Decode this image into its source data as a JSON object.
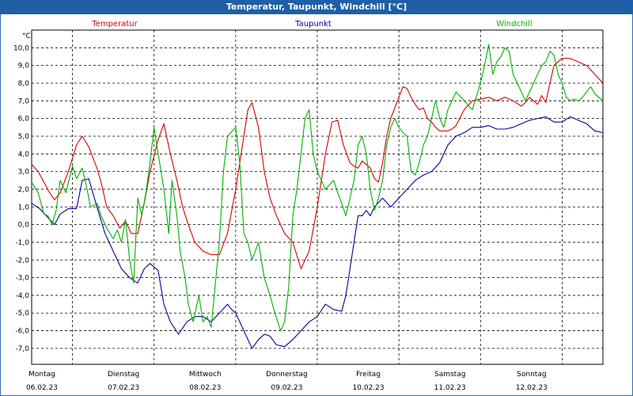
{
  "window": {
    "title": "Temperatur, Taupunkt, Windchill [°C]"
  },
  "chart_data": {
    "type": "line",
    "title": "Temperatur, Taupunkt, Windchill [°C]",
    "ylabel": "°C",
    "ylim": [
      -7.9,
      11.0
    ],
    "yticks": [
      -7.0,
      -6.0,
      -5.0,
      -4.0,
      -3.0,
      -2.0,
      -1.0,
      0.0,
      1.0,
      2.0,
      3.0,
      4.0,
      5.0,
      6.0,
      7.0,
      8.0,
      9.0,
      10.0
    ],
    "ytick_labels": [
      "-7,0",
      "-6,0",
      "-5,0",
      "-4,0",
      "-3,0",
      "-2,0",
      "-1,0",
      "0,0",
      "1,0",
      "2,0",
      "3,0",
      "4,0",
      "5,0",
      "6,0",
      "7,0",
      "8,0",
      "9,0",
      "10,0"
    ],
    "xlim": [
      0,
      7.0
    ],
    "x_unit": "days since Montag 06.02.23 00:00",
    "day_ticks": [
      {
        "day": "Montag",
        "date": "06.02.23"
      },
      {
        "day": "Dienstag",
        "date": "07.02.23"
      },
      {
        "day": "Mittwoch",
        "date": "08.02.23"
      },
      {
        "day": "Donnerstag",
        "date": "09.02.23"
      },
      {
        "day": "Freitag",
        "date": "10.02.23"
      },
      {
        "day": "Samstag",
        "date": "11.02.23"
      },
      {
        "day": "Sonntag",
        "date": "12.02.23"
      }
    ],
    "grid": true,
    "series": [
      {
        "name": "Temperatur",
        "color": "#d40000",
        "x": [
          0,
          0.08,
          0.15,
          0.22,
          0.28,
          0.35,
          0.45,
          0.55,
          0.62,
          0.7,
          0.8,
          0.85,
          0.92,
          1.0,
          1.08,
          1.15,
          1.22,
          1.3,
          1.38,
          1.45,
          1.55,
          1.62,
          1.7,
          1.78,
          1.85,
          1.92,
          2.0,
          2.1,
          2.2,
          2.3,
          2.4,
          2.5,
          2.6,
          2.65,
          2.7,
          2.78,
          2.85,
          2.92,
          3.0,
          3.1,
          3.2,
          3.3,
          3.4,
          3.5,
          3.6,
          3.68,
          3.75,
          3.82,
          3.9,
          3.95,
          4.0,
          4.05,
          4.1,
          4.15,
          4.2,
          4.25,
          4.3,
          4.35,
          4.4,
          4.5,
          4.55,
          4.6,
          4.65,
          4.7,
          4.75,
          4.8,
          4.85,
          4.9,
          4.95,
          5.0,
          5.05,
          5.1,
          5.15,
          5.2,
          5.3,
          5.4,
          5.5,
          5.6,
          5.7,
          5.8,
          5.9,
          6.0,
          6.05,
          6.1,
          6.15,
          6.2,
          6.25,
          6.3,
          6.35,
          6.4,
          6.5,
          6.6,
          6.7,
          6.8,
          6.9,
          7.0
        ],
        "y": [
          3.4,
          3.0,
          2.4,
          1.8,
          1.4,
          1.8,
          3.0,
          4.5,
          5.0,
          4.4,
          3.2,
          2.4,
          1.0,
          0.5,
          -0.2,
          0.2,
          -0.5,
          -0.5,
          1.2,
          3.0,
          4.8,
          5.7,
          4.0,
          2.5,
          1.0,
          0.0,
          -1.0,
          -1.5,
          -1.7,
          -1.7,
          -0.5,
          2.0,
          5.0,
          6.5,
          6.9,
          5.5,
          3.0,
          1.5,
          0.5,
          -0.5,
          -1.0,
          -2.5,
          -1.5,
          1.0,
          4.0,
          5.8,
          5.9,
          4.5,
          3.5,
          3.3,
          3.2,
          3.6,
          3.4,
          3.2,
          2.6,
          2.4,
          3.5,
          5.0,
          6.0,
          7.2,
          7.8,
          7.7,
          7.2,
          6.8,
          6.5,
          6.6,
          6.0,
          5.8,
          5.5,
          5.3,
          5.3,
          5.3,
          5.4,
          5.6,
          6.5,
          7.0,
          7.1,
          7.2,
          7.0,
          7.2,
          7.0,
          6.7,
          6.9,
          7.2,
          7.0,
          6.8,
          7.3,
          6.9,
          8.0,
          9.0,
          9.4,
          9.4,
          9.2,
          9.0,
          8.5,
          8.0
        ]
      },
      {
        "name": "Taupunkt",
        "color": "#00009c",
        "x": [
          0,
          0.1,
          0.2,
          0.28,
          0.35,
          0.45,
          0.55,
          0.62,
          0.7,
          0.8,
          0.9,
          1.0,
          1.1,
          1.2,
          1.3,
          1.38,
          1.45,
          1.55,
          1.62,
          1.7,
          1.8,
          1.9,
          2.0,
          2.1,
          2.2,
          2.3,
          2.4,
          2.45,
          2.5,
          2.6,
          2.65,
          2.7,
          2.78,
          2.85,
          2.92,
          3.0,
          3.1,
          3.2,
          3.3,
          3.4,
          3.5,
          3.6,
          3.7,
          3.8,
          3.85,
          3.9,
          3.95,
          4.0,
          4.05,
          4.1,
          4.15,
          4.2,
          4.3,
          4.4,
          4.5,
          4.6,
          4.7,
          4.8,
          4.9,
          5.0,
          5.1,
          5.2,
          5.3,
          5.4,
          5.5,
          5.6,
          5.7,
          5.8,
          5.9,
          6.0,
          6.1,
          6.2,
          6.3,
          6.4,
          6.5,
          6.6,
          6.7,
          6.8,
          6.9,
          7.0
        ],
        "y": [
          1.2,
          0.9,
          0.4,
          0.0,
          0.6,
          0.9,
          0.9,
          2.5,
          2.6,
          1.0,
          -0.5,
          -1.5,
          -2.5,
          -3.0,
          -3.3,
          -2.5,
          -2.2,
          -2.6,
          -4.5,
          -5.5,
          -6.2,
          -5.5,
          -5.2,
          -5.2,
          -5.5,
          -5.0,
          -4.5,
          -4.8,
          -5.0,
          -6.0,
          -6.5,
          -7.0,
          -6.5,
          -6.2,
          -6.3,
          -6.8,
          -6.9,
          -6.5,
          -6.0,
          -5.5,
          -5.2,
          -4.5,
          -4.8,
          -4.9,
          -4.0,
          -2.5,
          -1.0,
          0.5,
          0.5,
          0.8,
          0.5,
          1.0,
          1.5,
          1.0,
          1.5,
          2.0,
          2.5,
          2.8,
          3.0,
          3.5,
          4.5,
          5.0,
          5.2,
          5.5,
          5.5,
          5.6,
          5.4,
          5.4,
          5.5,
          5.7,
          5.9,
          6.0,
          6.1,
          5.8,
          5.8,
          6.1,
          5.9,
          5.7,
          5.3,
          5.2
        ]
      },
      {
        "name": "Windchill",
        "color": "#00b000",
        "x": [
          0,
          0.08,
          0.15,
          0.2,
          0.25,
          0.3,
          0.35,
          0.42,
          0.5,
          0.55,
          0.62,
          0.68,
          0.72,
          0.8,
          0.85,
          0.92,
          1.0,
          1.05,
          1.1,
          1.15,
          1.2,
          1.25,
          1.3,
          1.35,
          1.4,
          1.45,
          1.5,
          1.55,
          1.62,
          1.68,
          1.72,
          1.78,
          1.82,
          1.88,
          1.92,
          1.98,
          2.05,
          2.1,
          2.15,
          2.2,
          2.3,
          2.35,
          2.4,
          2.5,
          2.55,
          2.6,
          2.65,
          2.7,
          2.78,
          2.85,
          2.92,
          2.98,
          3.05,
          3.1,
          3.15,
          3.2,
          3.25,
          3.3,
          3.35,
          3.4,
          3.45,
          3.5,
          3.55,
          3.6,
          3.7,
          3.75,
          3.8,
          3.85,
          3.9,
          3.95,
          4.0,
          4.05,
          4.1,
          4.15,
          4.2,
          4.25,
          4.3,
          4.35,
          4.4,
          4.45,
          4.5,
          4.55,
          4.6,
          4.65,
          4.7,
          4.75,
          4.8,
          4.85,
          4.9,
          4.95,
          5.0,
          5.05,
          5.1,
          5.15,
          5.2,
          5.3,
          5.4,
          5.5,
          5.55,
          5.6,
          5.65,
          5.7,
          5.75,
          5.8,
          5.85,
          5.9,
          5.95,
          6.0,
          6.05,
          6.1,
          6.15,
          6.2,
          6.25,
          6.3,
          6.35,
          6.4,
          6.45,
          6.5,
          6.55,
          6.6,
          6.65,
          6.7,
          6.75,
          6.8,
          6.85,
          6.9,
          6.95,
          7.0
        ],
        "y": [
          2.4,
          1.8,
          0.6,
          0.5,
          0.0,
          0.8,
          2.5,
          1.8,
          3.3,
          2.6,
          3.2,
          2.0,
          1.0,
          1.2,
          0.5,
          -0.2,
          -0.8,
          -0.3,
          -1.0,
          0.3,
          -2.0,
          -3.3,
          1.5,
          0.5,
          1.8,
          3.5,
          5.5,
          4.0,
          2.0,
          -0.5,
          2.5,
          0.5,
          -1.5,
          -3.0,
          -4.5,
          -5.5,
          -4.0,
          -5.5,
          -5.2,
          -5.8,
          -1.0,
          3.0,
          5.0,
          5.5,
          3.5,
          -0.5,
          -1.0,
          -2.0,
          -1.0,
          -3.0,
          -4.0,
          -5.0,
          -6.0,
          -5.5,
          -3.5,
          0.5,
          2.0,
          4.0,
          6.0,
          6.5,
          4.0,
          3.0,
          2.5,
          2.0,
          2.5,
          1.8,
          1.2,
          0.5,
          1.5,
          2.5,
          4.5,
          5.0,
          4.0,
          2.0,
          0.8,
          1.5,
          2.5,
          4.5,
          5.5,
          6.0,
          5.5,
          5.2,
          5.0,
          3.0,
          2.8,
          3.5,
          4.5,
          5.0,
          6.0,
          7.0,
          6.0,
          5.5,
          6.5,
          7.0,
          7.5,
          7.0,
          6.5,
          8.0,
          9.0,
          10.2,
          8.5,
          9.2,
          9.5,
          10.0,
          9.8,
          8.5,
          8.0,
          7.5,
          7.0,
          7.5,
          8.0,
          8.5,
          9.0,
          9.2,
          9.8,
          9.6,
          8.5,
          8.0,
          7.2,
          7.0,
          7.1,
          7.0,
          7.2,
          7.5,
          7.8,
          7.4,
          7.2,
          7.0
        ]
      }
    ]
  }
}
